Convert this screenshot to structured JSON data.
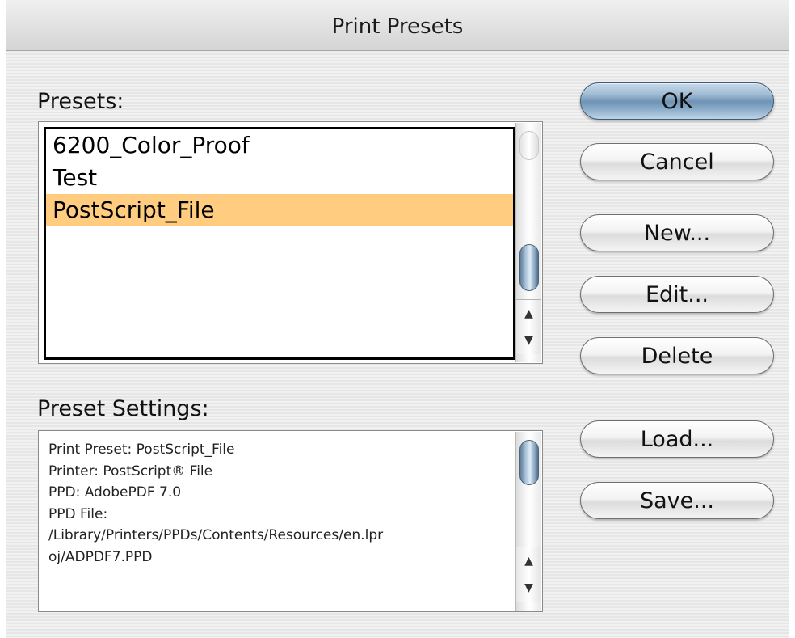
{
  "window": {
    "title": "Print Presets"
  },
  "presets": {
    "label": "Presets:",
    "items": [
      "6200_Color_Proof",
      "Test",
      "PostScript_File"
    ],
    "selected_index": 2
  },
  "preset_settings": {
    "label": "Preset Settings:",
    "lines": [
      "Print Preset: PostScript_File",
      "Printer: PostScript® File",
      "PPD: AdobePDF 7.0",
      "PPD File:",
      "/Library/Printers/PPDs/Contents/Resources/en.lpr",
      "oj/ADPDF7.PPD"
    ]
  },
  "buttons": {
    "ok": "OK",
    "cancel": "Cancel",
    "new": "New...",
    "edit": "Edit...",
    "delete": "Delete",
    "load": "Load...",
    "save": "Save..."
  },
  "icons": {
    "scroll_up": "▲",
    "scroll_down": "▼"
  },
  "colors": {
    "selection": "#ffcc80",
    "default_button": "#8fb0cc"
  }
}
